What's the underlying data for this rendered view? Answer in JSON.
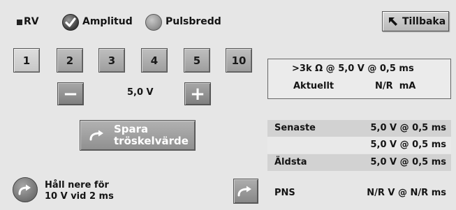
{
  "header": {
    "lead_label": "RV",
    "amplitude_label": "Amplitud",
    "pulse_width_label": "Pulsbredd",
    "back_label": "Tillbaka",
    "amplitude_checked": true,
    "pulse_width_checked": false
  },
  "steps": {
    "buttons": [
      "1",
      "2",
      "3",
      "4",
      "5",
      "10"
    ],
    "selected": "1"
  },
  "amplitude": {
    "minus_label": "−",
    "plus_label": "+",
    "value": "5,0 V"
  },
  "save": {
    "line1": "Spara",
    "line2": "tröskelvärde"
  },
  "hold": {
    "line1": "Håll nere för",
    "line2": "10 V vid 2 ms"
  },
  "info": {
    "line1": ">3k Ω @ 5,0 V @ 0,5 ms",
    "current_label": "Aktuellt",
    "current_value": "N/R  mA"
  },
  "history": {
    "latest_label": "Senaste",
    "oldest_label": "Äldsta",
    "rows": [
      "5,0 V @ 0,5 ms",
      "5,0 V @ 0,5 ms",
      "5,0 V @ 0,5 ms"
    ]
  },
  "pns": {
    "label": "PNS",
    "value": "N/R V @ N/R ms"
  },
  "icons": {
    "check": "check-icon",
    "back": "arrow-up-left-icon",
    "save": "curved-arrow-right-icon",
    "hold": "curved-arrow-right-icon",
    "pns": "curved-arrow-right-icon"
  }
}
